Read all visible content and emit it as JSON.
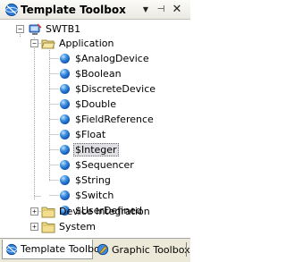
{
  "panel": {
    "title": "Template Toolbox",
    "menu_glyph": "▼",
    "pin_glyph": "⊣",
    "close_glyph": "✕",
    "icon": "toolbox-globe-icon"
  },
  "tree": {
    "root": {
      "label": "SWTB1",
      "icon": "workstation-icon",
      "expanded": true
    },
    "folders": [
      {
        "label": "Application",
        "icon": "folder-open-icon",
        "expanded": true,
        "items": [
          {
            "label": "$AnalogDevice",
            "icon": "template-ball-icon"
          },
          {
            "label": "$Boolean",
            "icon": "template-ball-icon"
          },
          {
            "label": "$DiscreteDevice",
            "icon": "template-ball-icon"
          },
          {
            "label": "$Double",
            "icon": "template-ball-icon"
          },
          {
            "label": "$FieldReference",
            "icon": "template-ball-icon"
          },
          {
            "label": "$Float",
            "icon": "template-ball-icon"
          },
          {
            "label": "$Integer",
            "icon": "template-ball-icon",
            "selected": true
          },
          {
            "label": "$Sequencer",
            "icon": "template-ball-icon"
          },
          {
            "label": "$String",
            "icon": "template-ball-icon"
          },
          {
            "label": "$Switch",
            "icon": "template-ball-icon"
          },
          {
            "label": "$UserDefined",
            "icon": "template-ball-icon"
          }
        ]
      },
      {
        "label": "Device Integration",
        "icon": "folder-closed-icon",
        "expanded": false
      },
      {
        "label": "System",
        "icon": "folder-closed-icon",
        "expanded": false
      }
    ]
  },
  "tabs": [
    {
      "label": "Template Toolbox",
      "icon": "toolbox-globe-icon",
      "active": true
    },
    {
      "label": "Graphic Toolbox",
      "icon": "graphic-toolbox-icon",
      "active": false
    }
  ],
  "colors": {
    "selection_bg": "#e0dfe3",
    "tab_strip_bg": "#ece9d8",
    "title_bg": "#ebe9e2"
  }
}
